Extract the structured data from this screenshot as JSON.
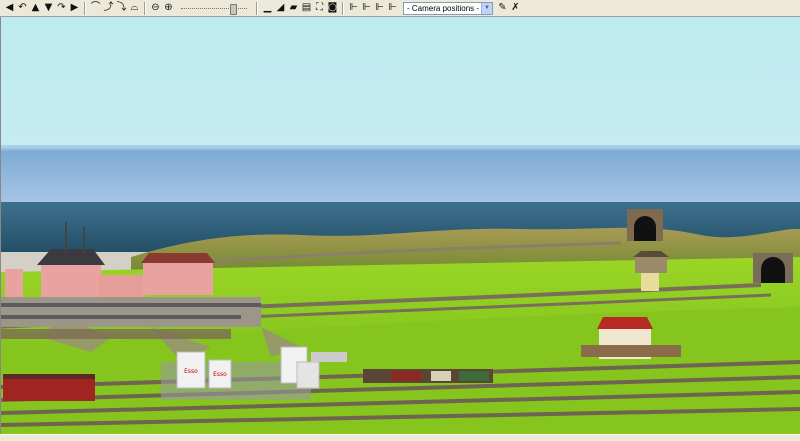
{
  "toolbar": {
    "nav_buttons": [
      {
        "icon": "arrow-left-icon",
        "glyph": "◀"
      },
      {
        "icon": "rotate-left-icon",
        "glyph": "↶"
      },
      {
        "icon": "arrow-up-icon",
        "glyph": "▲"
      },
      {
        "icon": "arrow-down-icon",
        "glyph": "▼"
      },
      {
        "icon": "rotate-right-icon",
        "glyph": "↷"
      },
      {
        "icon": "arrow-right-icon",
        "glyph": "▶"
      }
    ],
    "view_buttons": [
      {
        "icon": "look-up-icon",
        "glyph": "⌒"
      },
      {
        "icon": "tilt-up-icon",
        "glyph": "⤴"
      },
      {
        "icon": "tilt-down-icon",
        "glyph": "⤵"
      },
      {
        "icon": "look-down-icon",
        "glyph": "⌓"
      }
    ],
    "zoom_buttons": [
      {
        "icon": "zoom-out-icon",
        "glyph": "⊖"
      },
      {
        "icon": "zoom-in-icon",
        "glyph": "⊕"
      }
    ],
    "zoom_level": 0.82,
    "tool_buttons": [
      {
        "icon": "track-tool-icon",
        "glyph": "▁"
      },
      {
        "icon": "terrain-tool-icon",
        "glyph": "◢"
      },
      {
        "icon": "train-icon",
        "glyph": "▰"
      },
      {
        "icon": "rails-icon",
        "glyph": "▤"
      },
      {
        "icon": "fullscreen-icon",
        "glyph": "⛶"
      },
      {
        "icon": "camera-icon",
        "glyph": "◙"
      }
    ],
    "signal_buttons": [
      {
        "icon": "signal-1-icon",
        "glyph": "⊩"
      },
      {
        "icon": "signal-2-icon",
        "glyph": "⊩"
      },
      {
        "icon": "signal-3-icon",
        "glyph": "⊩"
      },
      {
        "icon": "signal-4-icon",
        "glyph": "⊩"
      }
    ],
    "camera_select_value": "- Camera positions -",
    "edit_buttons": [
      {
        "icon": "edit-camera-icon",
        "glyph": "✎"
      },
      {
        "icon": "delete-camera-icon",
        "glyph": "✗"
      }
    ]
  },
  "scene": {
    "sky_top": "#bfeaf0",
    "sky_horizon": "#d7e8f6",
    "sea": "#2b5e7a",
    "grass": "#8fcf1f",
    "grass_dark": "#6aa816",
    "track": "#7a6e5a",
    "station_roof": "#3a3a40",
    "station_wall": "#e8a3a0",
    "tank_label_1": "Esso",
    "tank_label_2": "Esso"
  }
}
